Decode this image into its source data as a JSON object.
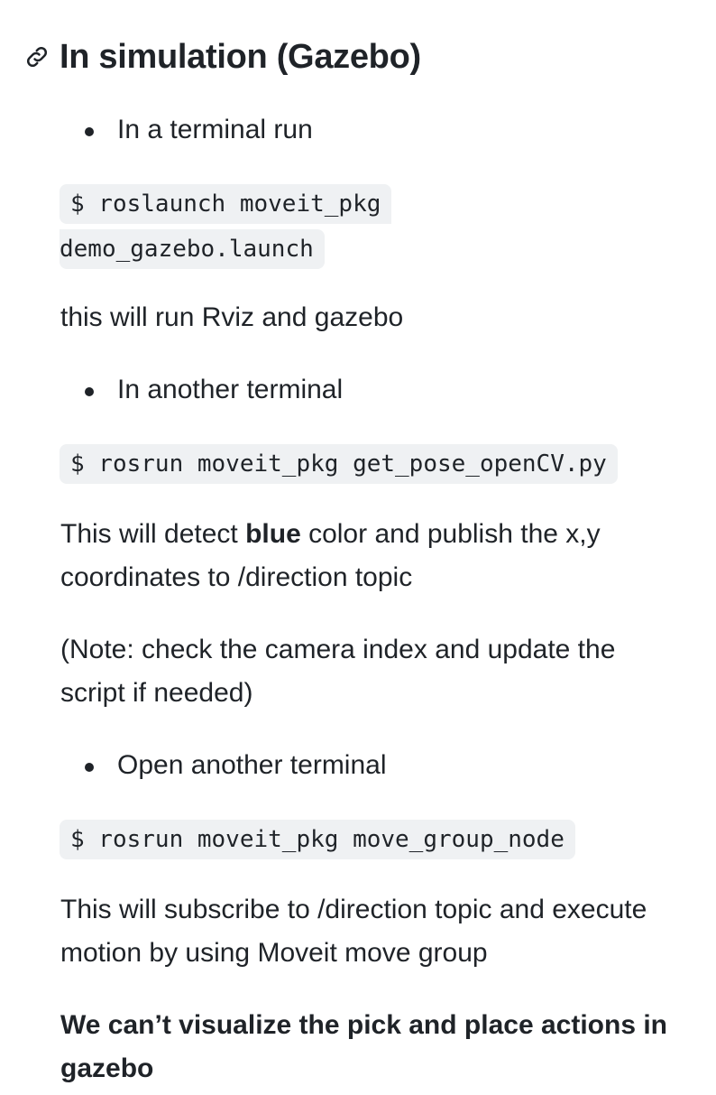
{
  "heading": {
    "icon": "link-icon",
    "title": "In simulation (Gazebo)"
  },
  "steps": [
    {
      "bullet": "In a terminal run",
      "command_line1": "$ roslaunch moveit_pkg",
      "command_line2": "demo_gazebo.launch",
      "note": "this will run Rviz and gazebo"
    },
    {
      "bullet": "In another terminal",
      "command": "$ rosrun moveit_pkg get_pose_openCV.py",
      "desc_before": "This will detect ",
      "desc_bold": "blue",
      "desc_after": " color and publish the x,y coordinates to /direction topic",
      "note": "(Note: check the camera index and update the script if needed)"
    },
    {
      "bullet": "Open another terminal",
      "command": "$ rosrun moveit_pkg move_group_node",
      "desc": "This will subscribe to /direction topic and execute motion by using Moveit move group"
    }
  ],
  "warning": "We can’t visualize the pick and place actions in gazebo"
}
